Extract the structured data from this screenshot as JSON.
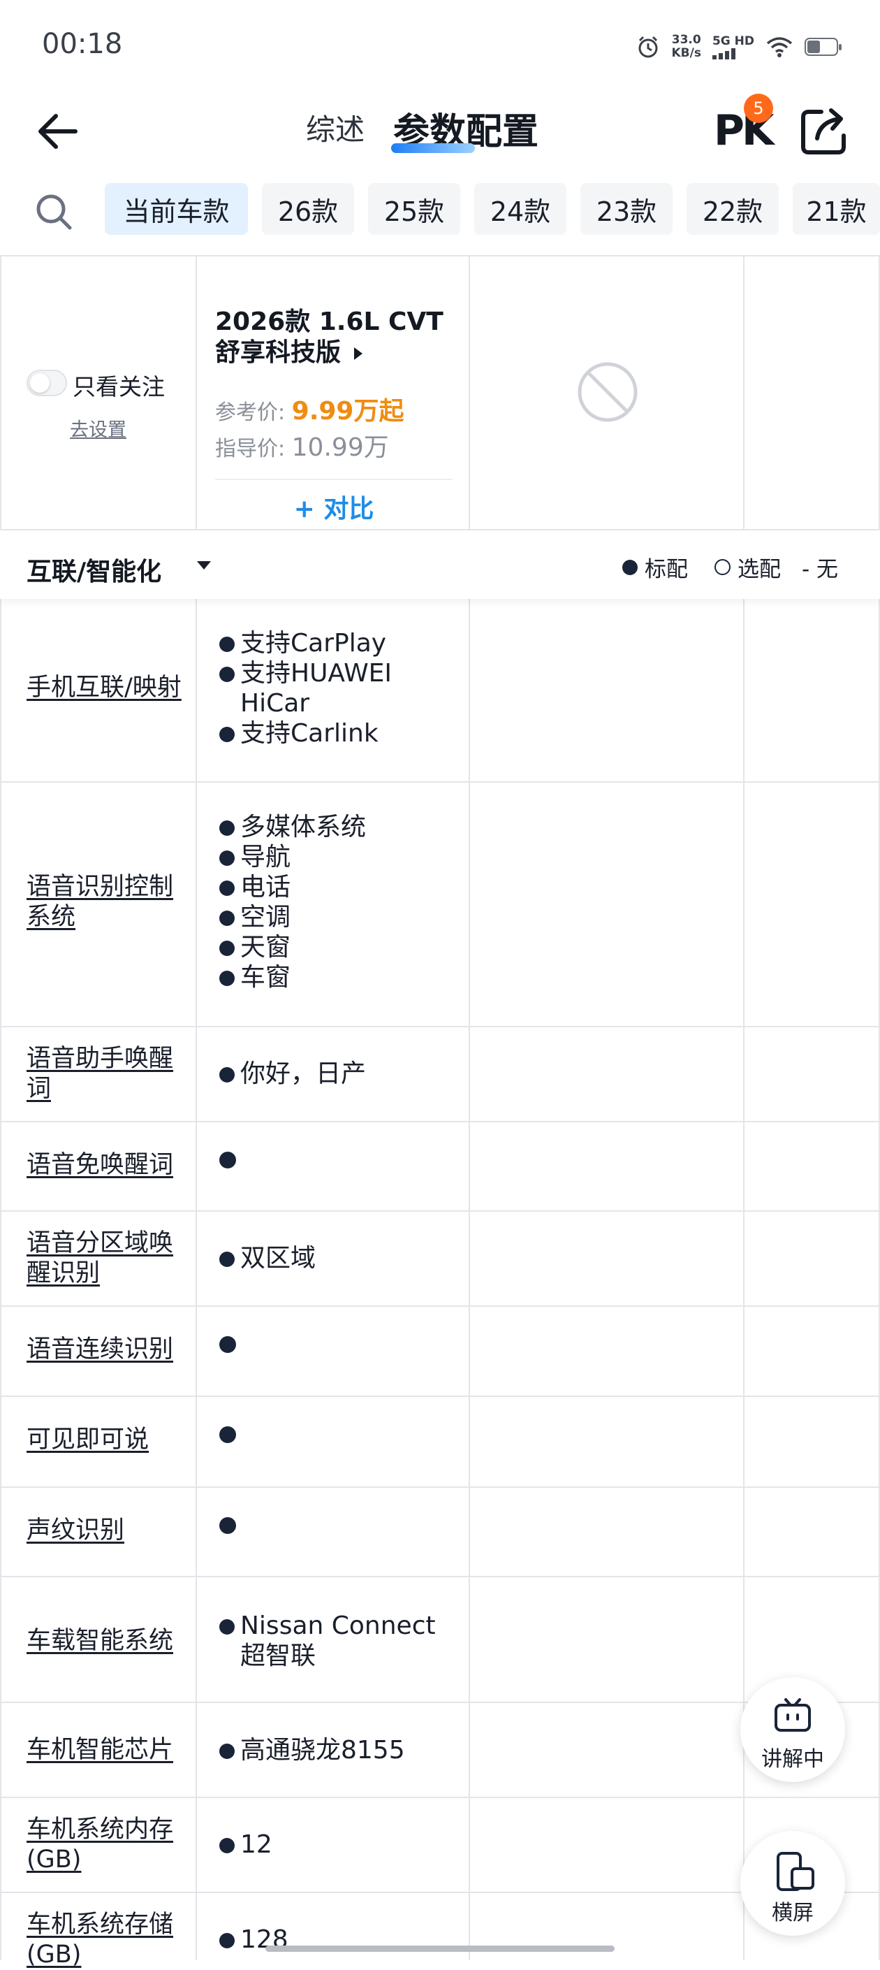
{
  "status_bar": {
    "time": "00:18",
    "speed_value": "33.0",
    "speed_unit": "KB/s",
    "network": "5G HD"
  },
  "header": {
    "tab_overview": "综述",
    "tab_params": "参数配置",
    "pk_label": "PK",
    "pk_badge": "5"
  },
  "year_tabs": [
    "当前车款",
    "26款",
    "25款",
    "24款",
    "23款",
    "22款",
    "21款"
  ],
  "car": {
    "follow_label": "只看关注",
    "go_setting": "去设置",
    "title": "2026款 1.6L CVT 舒享科技版",
    "ref_label": "参考价:",
    "ref_price": "9.99万起",
    "guide_label": "指导价:",
    "guide_price": "10.99万",
    "compare": "+ 对比"
  },
  "section": {
    "title": "互联/智能化",
    "legend_std": "标配",
    "legend_opt": "选配",
    "legend_none": "- 无"
  },
  "rows": [
    {
      "name": "手机互联/映射",
      "values": [
        "支持CarPlay",
        "支持HUAWEI HiCar",
        "支持Carlink"
      ]
    },
    {
      "name": "语音识别控制系统",
      "values": [
        "多媒体系统",
        "导航",
        "电话",
        "空调",
        "天窗",
        "车窗"
      ]
    },
    {
      "name": "语音助手唤醒词",
      "values": [
        "你好，日产"
      ]
    },
    {
      "name": "语音免唤醒词",
      "values": []
    },
    {
      "name": "语音分区域唤醒识别",
      "values": [
        "双区域"
      ]
    },
    {
      "name": "语音连续识别",
      "values": []
    },
    {
      "name": "可见即可说",
      "values": []
    },
    {
      "name": "声纹识别",
      "values": []
    },
    {
      "name": "车载智能系统",
      "values": [
        "Nissan Connect超智联"
      ]
    },
    {
      "name": "车机智能芯片",
      "values": [
        "高通骁龙8155"
      ]
    },
    {
      "name": "车机系统内存(GB)",
      "values": [
        "12"
      ]
    },
    {
      "name": "车机系统存储(GB)",
      "values": [
        "128"
      ]
    }
  ],
  "floating": {
    "explain": "讲解中",
    "landscape": "横屏"
  }
}
